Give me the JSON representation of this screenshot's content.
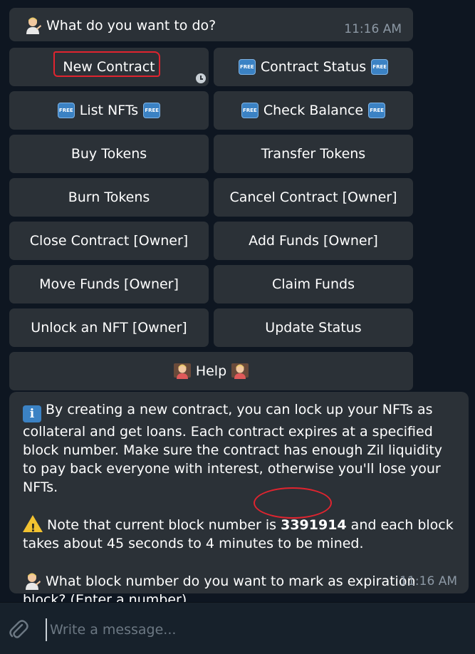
{
  "prompt_message": {
    "text": "What do you want to do?",
    "time": "11:16 AM"
  },
  "keyboard": {
    "new_contract": "New Contract",
    "contract_status": "Contract Status",
    "list_nfts": "List NFTs",
    "check_balance": "Check Balance",
    "buy_tokens": "Buy Tokens",
    "transfer_tokens": "Transfer Tokens",
    "burn_tokens": "Burn Tokens",
    "cancel_contract": "Cancel Contract [Owner]",
    "close_contract": "Close Contract [Owner]",
    "add_funds": "Add Funds [Owner]",
    "move_funds": "Move Funds [Owner]",
    "claim_funds": "Claim Funds",
    "unlock_nft": "Unlock an NFT [Owner]",
    "update_status": "Update Status",
    "help": "Help",
    "free_badge": "FREE"
  },
  "reply_message": {
    "para1": "By creating a new contract, you can lock up your NFTs as collateral and get loans. Each contract expires at a specified block number. Make sure the contract has enough Zil liquidity to pay back everyone with interest, otherwise you'll lose your NFTs.",
    "para2_before": "Note that current block number is ",
    "block_number": "3391914",
    "para2_after": " and each block takes about 45 seconds to 4 minutes to be mined.",
    "para3": "What block number do you want to mark as expiration block? (Enter a number)",
    "time": "11:16 AM"
  },
  "composer": {
    "placeholder": "Write a message..."
  },
  "colors": {
    "background": "#0e1621",
    "bubble": "#2b3137",
    "annotation_red": "#e0242f",
    "muted_text": "#8c98a4"
  },
  "icons": [
    "person-emoji-icon",
    "clock-icon",
    "free-badge-icon",
    "info-icon",
    "warning-icon",
    "paperclip-icon"
  ]
}
